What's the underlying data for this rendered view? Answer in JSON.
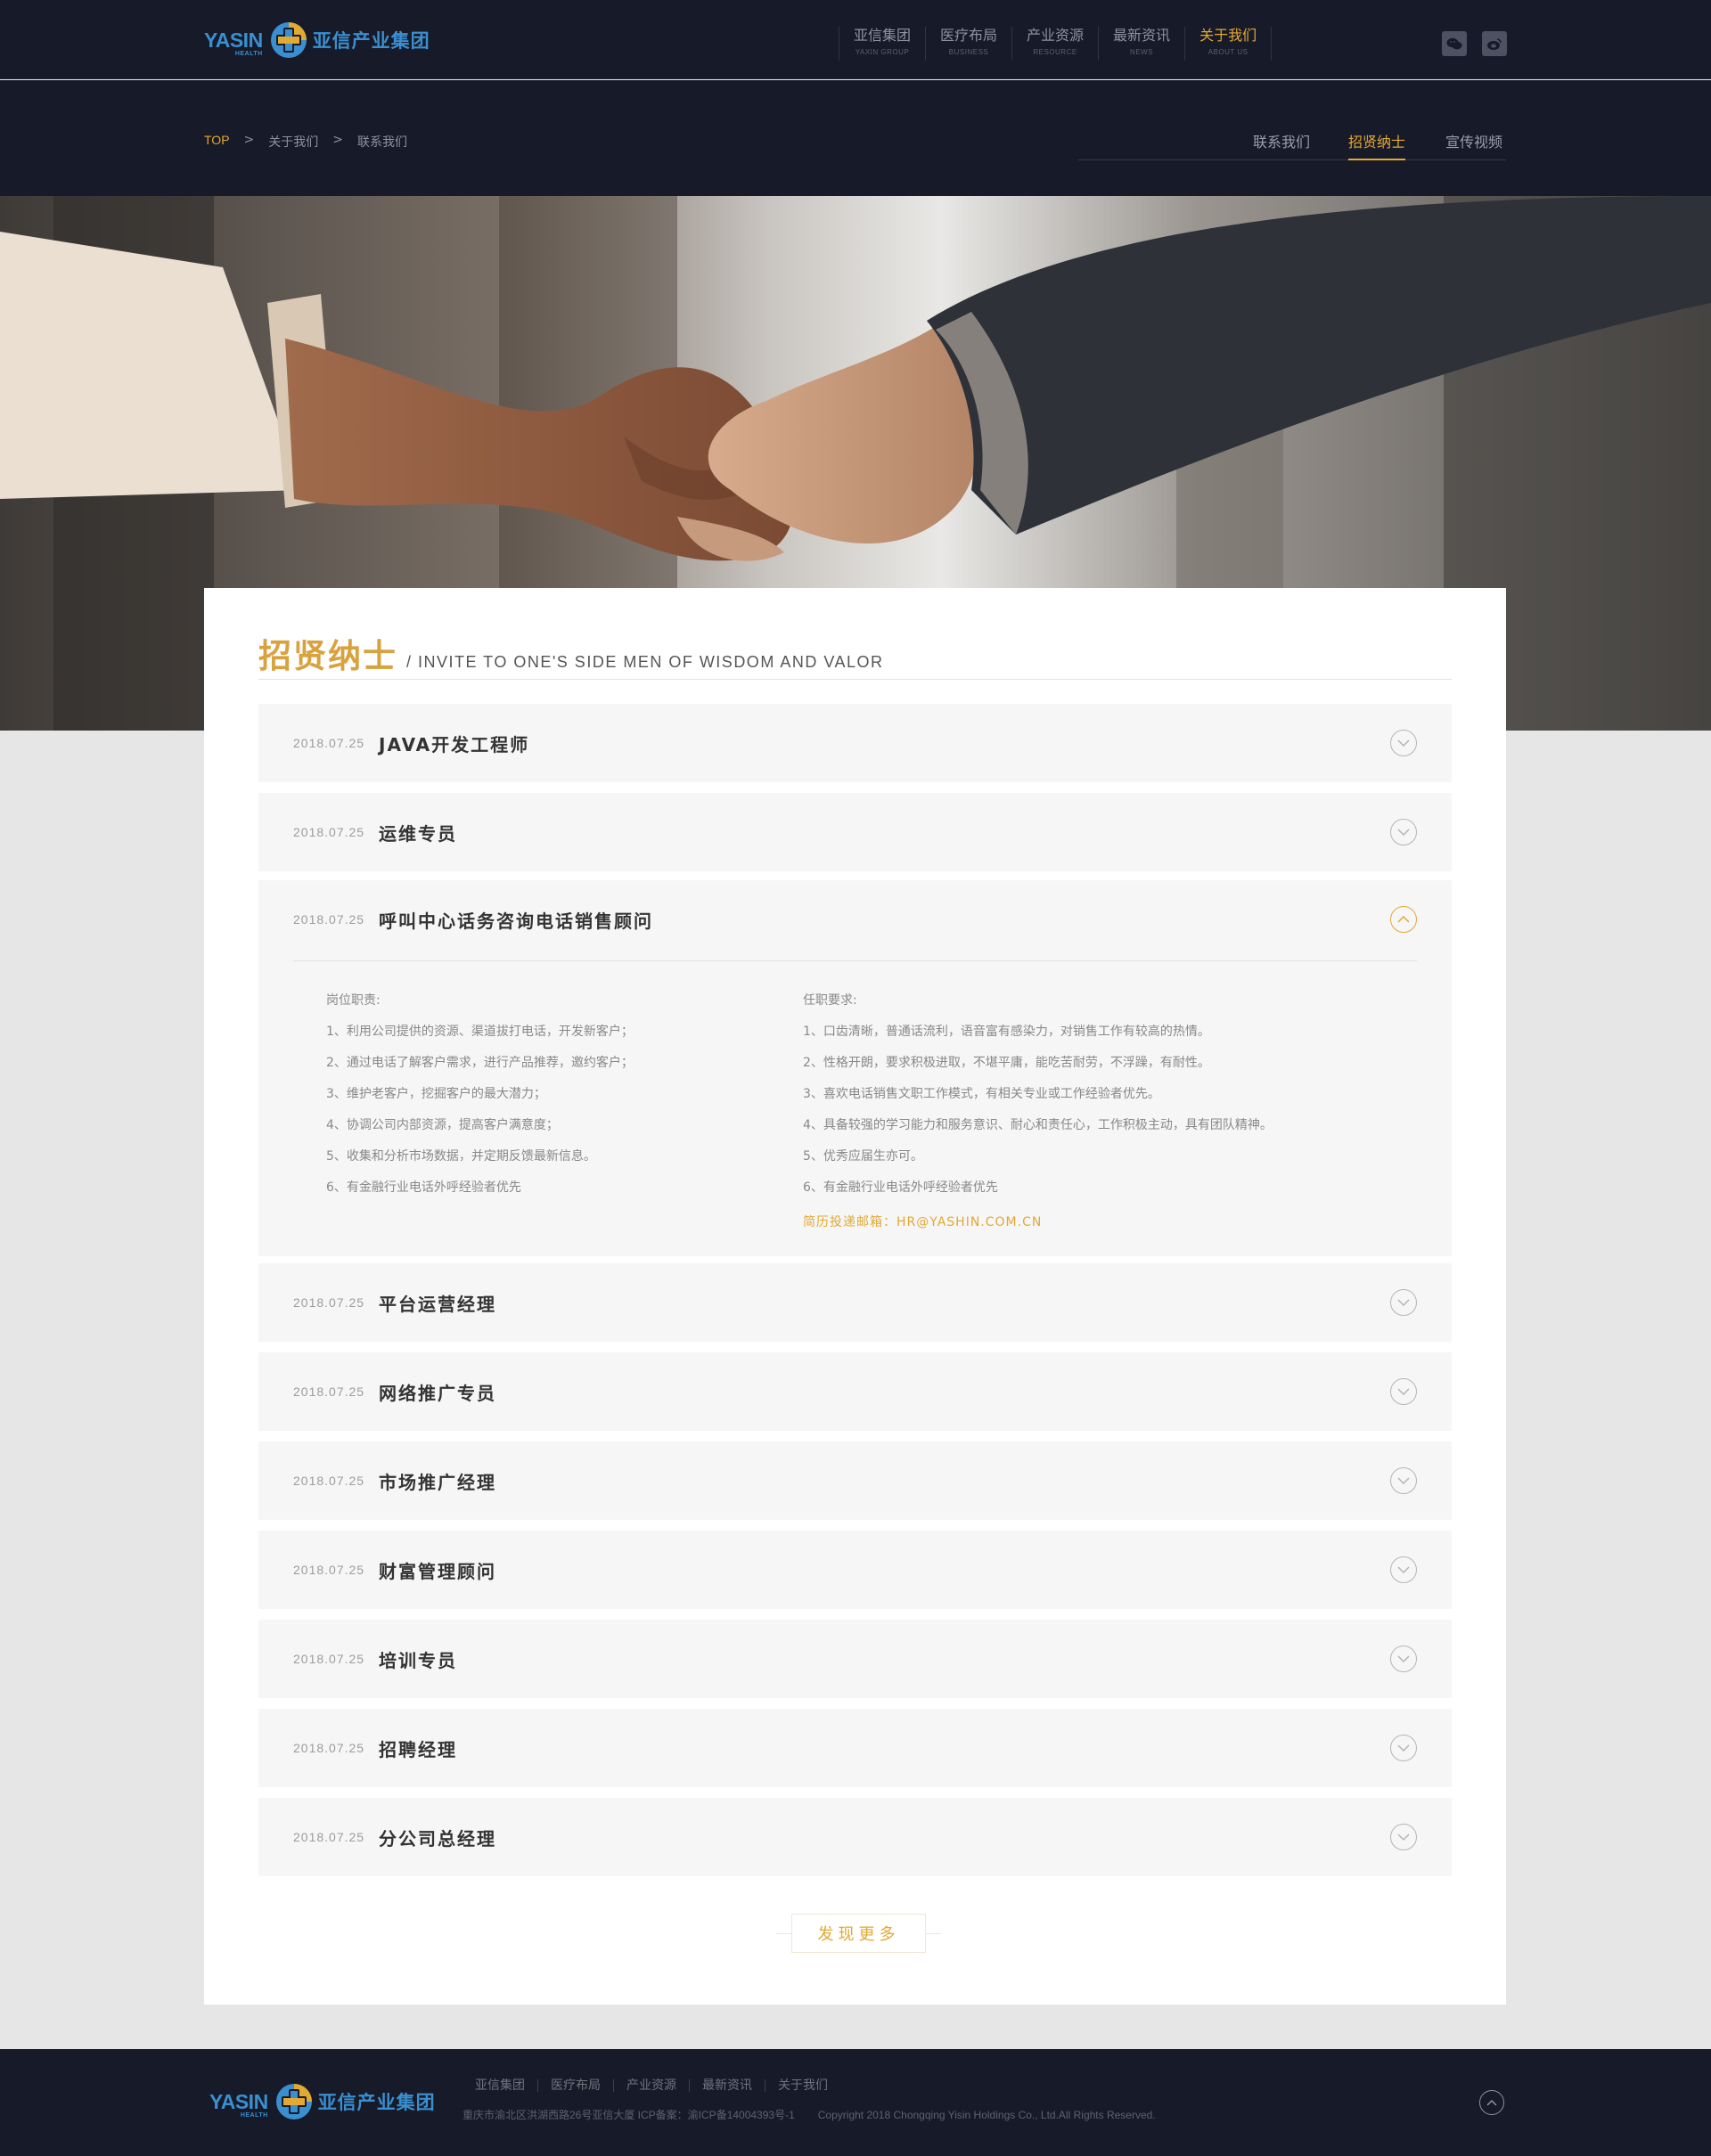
{
  "header": {
    "logo": {
      "en": "YASIN",
      "sub": "HEALTH",
      "cn": "亚信产业集团"
    },
    "nav": [
      {
        "cn": "亚信集团",
        "en": "YAXIN GROUP"
      },
      {
        "cn": "医疗布局",
        "en": "BUSINESS"
      },
      {
        "cn": "产业资源",
        "en": "RESOURCE"
      },
      {
        "cn": "最新资讯",
        "en": "NEWS"
      },
      {
        "cn": "关于我们",
        "en": "ABOUT US"
      }
    ],
    "social": [
      "wechat-icon",
      "weibo-icon"
    ]
  },
  "subbar": {
    "breadcrumb": [
      "TOP",
      "关于我们",
      "联系我们"
    ],
    "sep": ">",
    "tabs": [
      "联系我们",
      "招贤纳士",
      "宣传视频"
    ]
  },
  "section": {
    "title_cn": "招贤纳士",
    "title_en": "/ INVITE TO ONE'S SIDE MEN OF WISDOM AND VALOR"
  },
  "jobs": [
    {
      "date": "2018.07.25",
      "title": "JAVA开发工程师"
    },
    {
      "date": "2018.07.25",
      "title": "运维专员"
    },
    {
      "date": "2018.07.25",
      "title": "呼叫中心话务咨询电话销售顾问"
    },
    {
      "date": "2018.07.25",
      "title": "平台运营经理"
    },
    {
      "date": "2018.07.25",
      "title": "网络推广专员"
    },
    {
      "date": "2018.07.25",
      "title": "市场推广经理"
    },
    {
      "date": "2018.07.25",
      "title": "财富管理顾问"
    },
    {
      "date": "2018.07.25",
      "title": "培训专员"
    },
    {
      "date": "2018.07.25",
      "title": "招聘经理"
    },
    {
      "date": "2018.07.25",
      "title": "分公司总经理"
    }
  ],
  "detail": {
    "duty_title": "岗位职责:",
    "duties": [
      "1、利用公司提供的资源、渠道拔打电话，开发新客户；",
      "2、通过电话了解客户需求，进行产品推荐，邀约客户；",
      "3、维护老客户，挖掘客户的最大潜力；",
      "4、协调公司内部资源，提高客户满意度；",
      "5、收集和分析市场数据，并定期反馈最新信息。",
      "6、有金融行业电话外呼经验者优先"
    ],
    "req_title": "任职要求:",
    "requirements": [
      "1、口齿清晰，普通话流利，语音富有感染力，对销售工作有较高的热情。",
      "2、性格开朗，要求积极进取，不堪平庸，能吃苦耐劳，不浮躁，有耐性。",
      "3、喜欢电话销售文职工作模式，有相关专业或工作经验者优先。",
      "4、具备较强的学习能力和服务意识、耐心和责任心，工作积极主动，具有团队精神。",
      "5、优秀应届生亦可。",
      "6、有金融行业电话外呼经验者优先"
    ],
    "email": "简历投递邮箱：HR@YASHIN.COM.CN"
  },
  "more_label": "发现更多",
  "footer": {
    "links": [
      "亚信集团",
      "医疗布局",
      "产业资源",
      "最新资讯",
      "关于我们"
    ],
    "address": "重庆市渝北区洪湖西路26号亚信大厦 ICP备案：渝ICP备14004393号-1",
    "copyright": "Copyright  2018 Chongqing Yisin Holdings Co., Ltd.All Rights Reserved."
  },
  "colors": {
    "accent": "#e2a933",
    "dark": "#171a29",
    "logo_blue": "#3a8fd0"
  }
}
